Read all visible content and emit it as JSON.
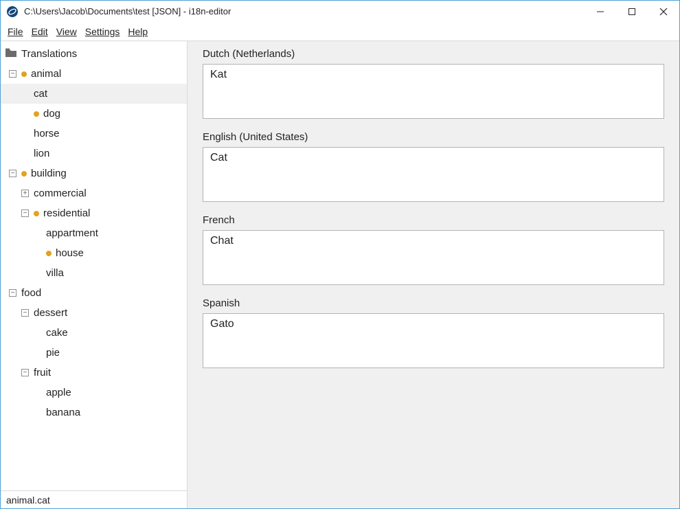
{
  "window": {
    "title": "C:\\Users\\Jacob\\Documents\\test [JSON] - i18n-editor"
  },
  "menu": {
    "file": "File",
    "edit": "Edit",
    "view": "View",
    "settings": "Settings",
    "help": "Help"
  },
  "tree": {
    "root": "Translations",
    "animal": "animal",
    "cat": "cat",
    "dog": "dog",
    "horse": "horse",
    "lion": "lion",
    "building": "building",
    "commercial": "commercial",
    "residential": "residential",
    "appartment": "appartment",
    "house": "house",
    "villa": "villa",
    "food": "food",
    "dessert": "dessert",
    "cake": "cake",
    "pie": "pie",
    "fruit": "fruit",
    "apple": "apple",
    "banana": "banana"
  },
  "editor": {
    "fields": [
      {
        "label": "Dutch (Netherlands)",
        "value": "Kat"
      },
      {
        "label": "English (United States)",
        "value": "Cat"
      },
      {
        "label": "French",
        "value": "Chat"
      },
      {
        "label": "Spanish",
        "value": "Gato"
      }
    ]
  },
  "status": {
    "path": "animal.cat"
  }
}
